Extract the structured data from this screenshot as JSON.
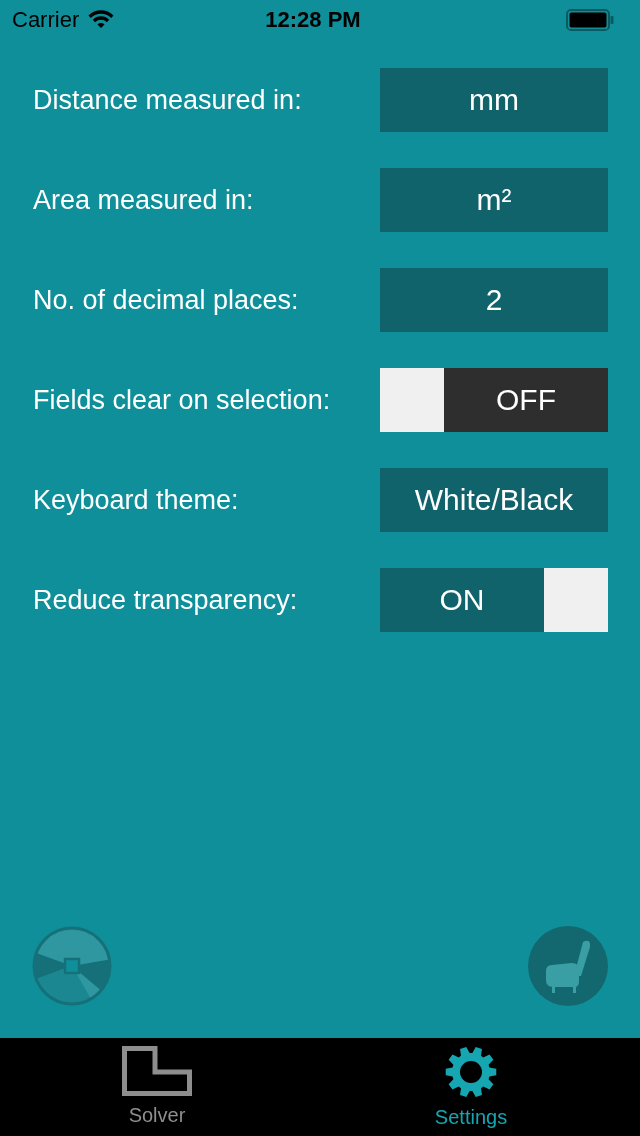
{
  "status_bar": {
    "carrier": "Carrier",
    "time": "12:28 PM"
  },
  "settings": [
    {
      "kind": "value",
      "label": "Distance measured in:",
      "value": "mm"
    },
    {
      "kind": "value",
      "label": "Area measured in:",
      "value": "m²"
    },
    {
      "kind": "value",
      "label": "No. of decimal places:",
      "value": "2"
    },
    {
      "kind": "toggle",
      "label": "Fields clear on selection:",
      "on": false,
      "value": "OFF"
    },
    {
      "kind": "value",
      "label": "Keyboard theme:",
      "value": "White/Black"
    },
    {
      "kind": "toggle",
      "label": "Reduce transparency:",
      "on": true,
      "value": "ON"
    }
  ],
  "tab_bar": {
    "tabs": [
      {
        "label": "Solver",
        "selected": false
      },
      {
        "label": "Settings",
        "selected": true
      }
    ]
  }
}
